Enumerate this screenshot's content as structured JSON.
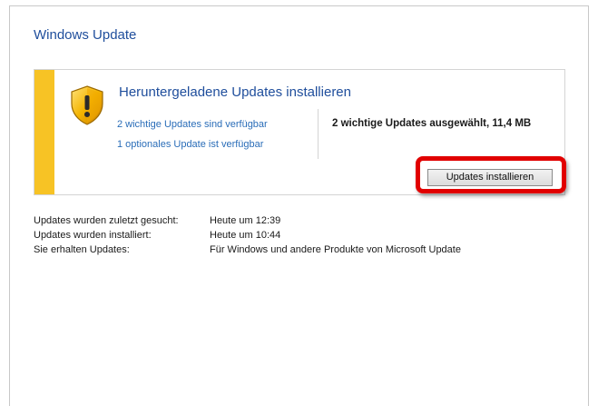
{
  "window": {
    "title": "Windows Update"
  },
  "panel": {
    "accent_color": "#f7c325",
    "icon": "warning-shield-icon",
    "title": "Heruntergeladene Updates installieren",
    "links": [
      "2 wichtige Updates sind verfügbar",
      "1 optionales Update ist verfügbar"
    ],
    "selected_info": "2 wichtige Updates ausgewählt, 11,4 MB",
    "install_button": "Updates installieren"
  },
  "highlight": {
    "color": "#e10000"
  },
  "status": [
    {
      "label": "Updates wurden zuletzt gesucht:",
      "value": "Heute um 12:39"
    },
    {
      "label": "Updates wurden installiert:",
      "value": "Heute um 10:44"
    },
    {
      "label": "Sie erhalten Updates:",
      "value": "Für Windows und andere Produkte von Microsoft Update"
    }
  ]
}
